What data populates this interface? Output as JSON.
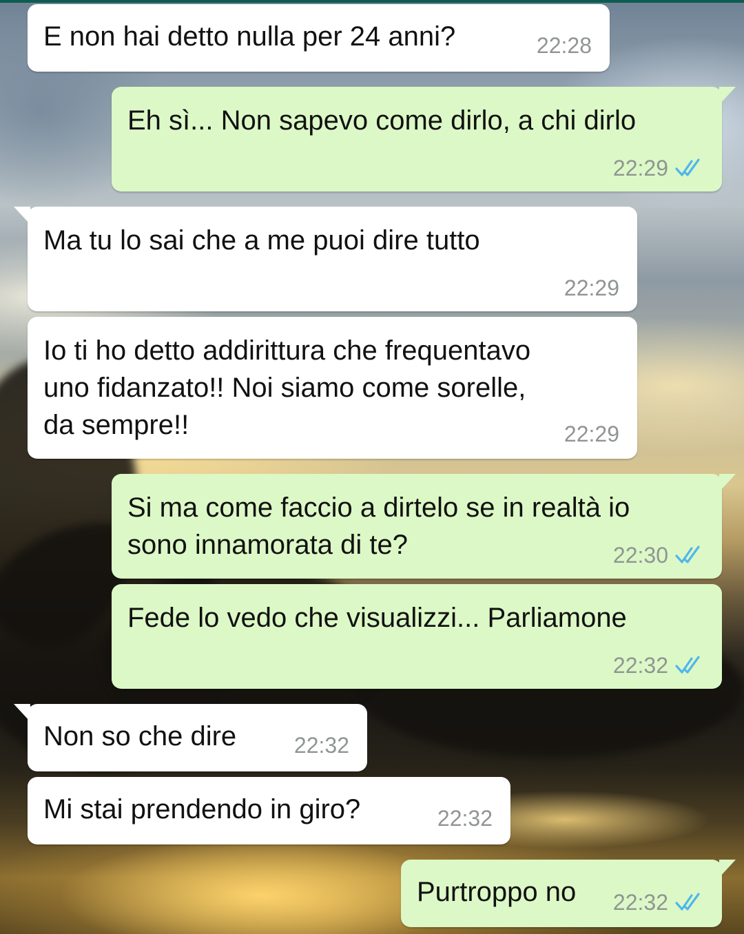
{
  "theme": {
    "incoming_bubble": "#ffffff",
    "outgoing_bubble": "#dcf8c6",
    "timestamp_color": "#8f9593",
    "read_receipt_color": "#4fb6ec"
  },
  "messages": [
    {
      "direction": "incoming",
      "text": "E non hai detto nulla per 24 anni?",
      "time": "22:28",
      "status": null
    },
    {
      "direction": "outgoing",
      "text": "Eh sì... Non sapevo come dirlo, a chi dirlo",
      "time": "22:29",
      "status": "read"
    },
    {
      "direction": "incoming",
      "text": "Ma tu lo sai che a me puoi dire tutto",
      "time": "22:29",
      "status": null
    },
    {
      "direction": "incoming",
      "text": "Io ti ho detto addirittura che frequentavo\nuno fidanzato!! Noi siamo come sorelle,\nda sempre!!",
      "time": "22:29",
      "status": null
    },
    {
      "direction": "outgoing",
      "text": "Si ma come faccio a dirtelo se in realtà io\nsono innamorata di te?",
      "time": "22:30",
      "status": "read"
    },
    {
      "direction": "outgoing",
      "text": "Fede lo vedo che visualizzi... Parliamone",
      "time": "22:32",
      "status": "read"
    },
    {
      "direction": "incoming",
      "text": "Non so che dire",
      "time": "22:32",
      "status": null
    },
    {
      "direction": "incoming",
      "text": "Mi stai prendendo in giro?",
      "time": "22:32",
      "status": null
    },
    {
      "direction": "outgoing",
      "text": "Purtroppo no",
      "time": "22:32",
      "status": "read"
    }
  ]
}
